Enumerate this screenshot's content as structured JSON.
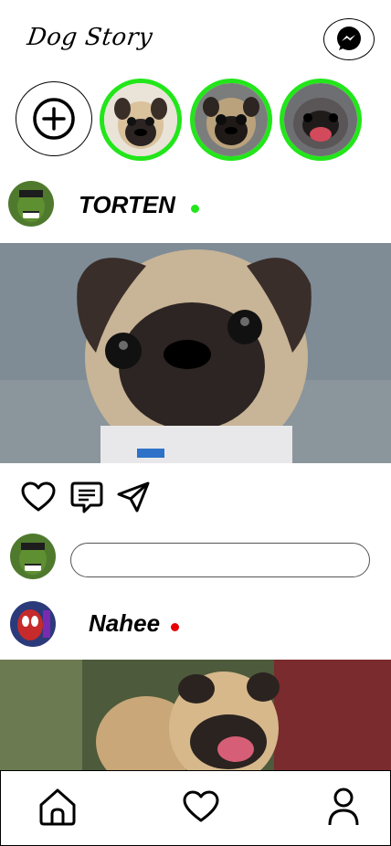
{
  "app": {
    "title": "Dog Story"
  },
  "header": {
    "messenger_icon": "messenger-icon"
  },
  "stories": {
    "add_icon": "plus-circle-icon",
    "items": [
      {
        "name": "story-1"
      },
      {
        "name": "story-2"
      },
      {
        "name": "story-3"
      }
    ],
    "ring_color": "#22e61a"
  },
  "posts": [
    {
      "username": "TORTEN",
      "status_color": "#22e61a"
    },
    {
      "username": "Nahee",
      "status_color": "#e60000"
    }
  ],
  "actions": {
    "like_icon": "heart-icon",
    "comment_icon": "comment-icon",
    "share_icon": "send-icon"
  },
  "comment": {
    "placeholder": ""
  },
  "bottom_nav": {
    "items": [
      "home-icon",
      "heart-icon",
      "profile-icon"
    ]
  }
}
